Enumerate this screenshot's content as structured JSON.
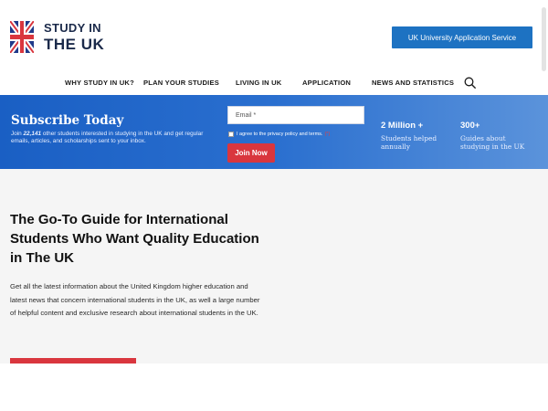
{
  "header": {
    "logo_line1": "STUDY IN",
    "logo_line2": "THE UK",
    "cta_label": "UK University Application Service"
  },
  "nav": {
    "items": [
      {
        "label": "WHY STUDY IN UK?"
      },
      {
        "label": "PLAN YOUR STUDIES"
      },
      {
        "label": "LIVING IN UK"
      },
      {
        "label": "APPLICATION"
      },
      {
        "label": "NEWS AND STATISTICS"
      }
    ],
    "search_icon": "search-icon"
  },
  "subscribe": {
    "title": "Subscribe Today",
    "desc_prefix": "Join ",
    "count": "22,141",
    "desc_suffix": " other students interested in studying in the UK and get regular emails, articles, and scholarships sent to your inbox.",
    "email_placeholder": "Email *",
    "agree_text": "I agree to the privacy policy and terms.",
    "agree_required": "(*)",
    "join_label": "Join Now",
    "stats": [
      {
        "value": "2 Million +",
        "label": "Students helped annually"
      },
      {
        "value": "300+",
        "label": "Guides about studying in the UK"
      }
    ]
  },
  "hero": {
    "title": "The Go-To Guide for International Students Who Want Quality Education in The UK",
    "description": "Get all the latest information about the United Kingdom higher education and latest news that concern international students in the UK, as well a large number of helpful content and exclusive research about international students in the UK."
  },
  "colors": {
    "brand_blue": "#1d72c2",
    "accent_red": "#d9363e",
    "navy": "#1b2a4a"
  }
}
